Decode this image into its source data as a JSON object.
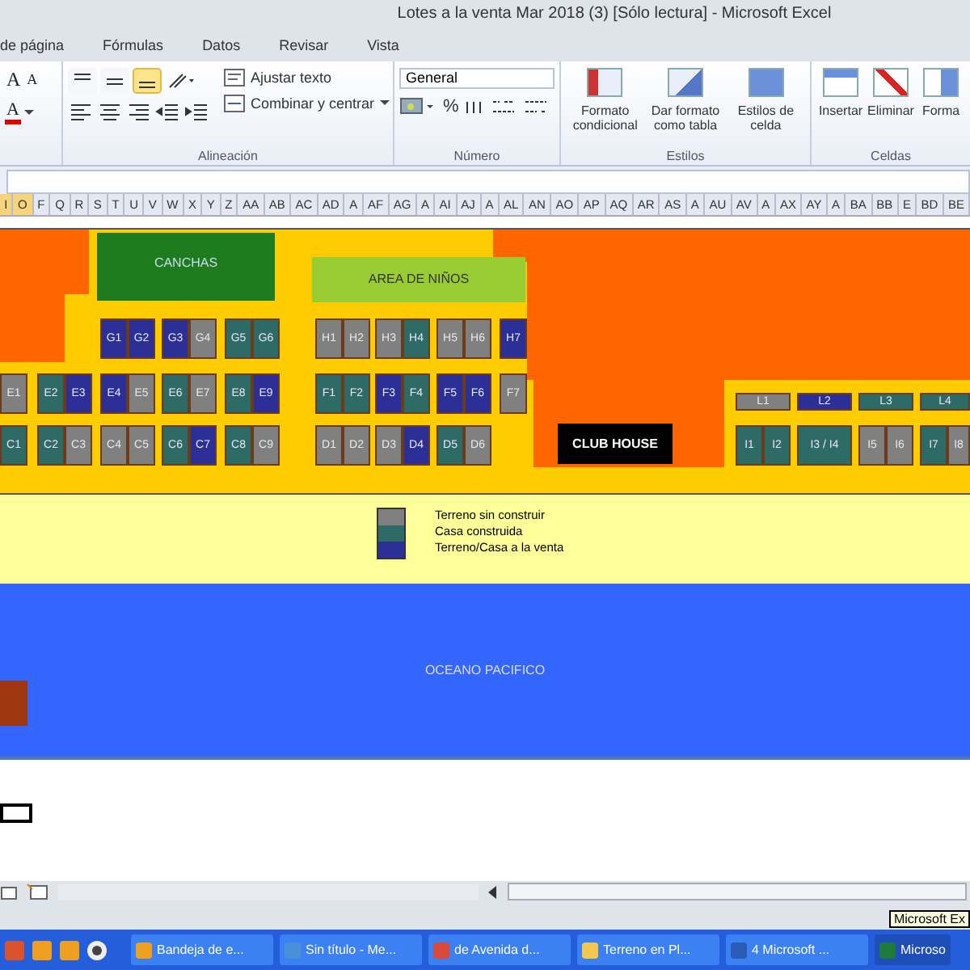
{
  "window": {
    "title": "Lotes a la venta Mar 2018 (3)  [Sólo lectura]  -  Microsoft Excel"
  },
  "ribbon_tabs": [
    "de página",
    "Fórmulas",
    "Datos",
    "Revisar",
    "Vista"
  ],
  "ribbon": {
    "font": {
      "grow": "A",
      "shrink": "A",
      "font_color": "A"
    },
    "align_buttons": [
      {
        "kind": "top",
        "on": false
      },
      {
        "kind": "middle",
        "on": false
      },
      {
        "kind": "bottom",
        "on": true
      }
    ],
    "alignment": {
      "label": "Alineación",
      "wrap_text": "Ajustar texto",
      "merge": "Combinar y centrar"
    },
    "number": {
      "label": "Número",
      "format": "General",
      "percent": "%"
    },
    "styles": {
      "label": "Estilos",
      "buttons": [
        {
          "kind": "conditional",
          "label": "Formato condicional"
        },
        {
          "kind": "table",
          "label": "Dar formato como tabla"
        },
        {
          "kind": "cell",
          "label": "Estilos de celda"
        }
      ]
    },
    "cells": {
      "label": "Celdas",
      "buttons": [
        {
          "kind": "insert",
          "label": "Insertar"
        },
        {
          "kind": "delete",
          "label": "Eliminar"
        },
        {
          "kind": "format",
          "label": "Forma"
        }
      ]
    }
  },
  "column_headers": [
    {
      "label": "I",
      "selected": true
    },
    {
      "label": "O",
      "selected": true
    },
    {
      "label": "F",
      "selected": false
    },
    {
      "label": "Q",
      "selected": false
    },
    {
      "label": "R",
      "selected": false
    },
    {
      "label": "S",
      "selected": false
    },
    {
      "label": "T",
      "selected": false
    },
    {
      "label": "U",
      "selected": false
    },
    {
      "label": "V",
      "selected": false
    },
    {
      "label": "W",
      "selected": false
    },
    {
      "label": "X",
      "selected": false
    },
    {
      "label": "Y",
      "selected": false
    },
    {
      "label": "Z",
      "selected": false
    },
    {
      "label": "AA",
      "selected": false
    },
    {
      "label": "AB",
      "selected": false
    },
    {
      "label": "AC",
      "selected": false
    },
    {
      "label": "AD",
      "selected": false
    },
    {
      "label": "A",
      "selected": false
    },
    {
      "label": "AF",
      "selected": false
    },
    {
      "label": "AG",
      "selected": false
    },
    {
      "label": "A",
      "selected": false
    },
    {
      "label": "AI",
      "selected": false
    },
    {
      "label": "AJ",
      "selected": false
    },
    {
      "label": "A",
      "selected": false
    },
    {
      "label": "AL",
      "selected": false
    },
    {
      "label": "AN",
      "selected": false
    },
    {
      "label": "AO",
      "selected": false
    },
    {
      "label": "AP",
      "selected": false
    },
    {
      "label": "AQ",
      "selected": false
    },
    {
      "label": "AR",
      "selected": false
    },
    {
      "label": "AS",
      "selected": false
    },
    {
      "label": "A",
      "selected": false
    },
    {
      "label": "AU",
      "selected": false
    },
    {
      "label": "AV",
      "selected": false
    },
    {
      "label": "A",
      "selected": false
    },
    {
      "label": "AX",
      "selected": false
    },
    {
      "label": "AY",
      "selected": false
    },
    {
      "label": "A",
      "selected": false
    },
    {
      "label": "BA",
      "selected": false
    },
    {
      "label": "BB",
      "selected": false
    },
    {
      "label": "E",
      "selected": false
    },
    {
      "label": "BD",
      "selected": false
    },
    {
      "label": "BE",
      "selected": false
    }
  ],
  "map": {
    "courts": "CANCHAS",
    "kids_area": "AREA DE NIÑOS",
    "club_house": "CLUB HOUSE",
    "ocean": "OCEANO PACIFICO",
    "lot_rows": [
      {
        "groups": [
          [
            {
              "label": "G1",
              "kind": "for_sale"
            },
            {
              "label": "G2",
              "kind": "for_sale"
            }
          ],
          [
            {
              "label": "G3",
              "kind": "for_sale"
            },
            {
              "label": "G4",
              "kind": "vacant"
            }
          ],
          [
            {
              "label": "G5",
              "kind": "built"
            },
            {
              "label": "G6",
              "kind": "built"
            }
          ],
          [
            {
              "label": "H1",
              "kind": "vacant"
            },
            {
              "label": "H2",
              "kind": "vacant"
            }
          ],
          [
            {
              "label": "H3",
              "kind": "vacant"
            },
            {
              "label": "H4",
              "kind": "built"
            }
          ],
          [
            {
              "label": "H5",
              "kind": "vacant"
            },
            {
              "label": "H6",
              "kind": "vacant"
            }
          ],
          [
            {
              "label": "H7",
              "kind": "for_sale"
            }
          ]
        ]
      },
      {
        "groups": [
          [
            {
              "label": "E1",
              "kind": "vacant"
            }
          ],
          [
            {
              "label": "E2",
              "kind": "built"
            },
            {
              "label": "E3",
              "kind": "for_sale"
            }
          ],
          [
            {
              "label": "E4",
              "kind": "for_sale"
            },
            {
              "label": "E5",
              "kind": "vacant"
            }
          ],
          [
            {
              "label": "E6",
              "kind": "built"
            },
            {
              "label": "E7",
              "kind": "vacant"
            }
          ],
          [
            {
              "label": "E8",
              "kind": "built"
            },
            {
              "label": "E9",
              "kind": "for_sale"
            }
          ],
          [
            {
              "label": "F1",
              "kind": "built"
            },
            {
              "label": "F2",
              "kind": "built"
            }
          ],
          [
            {
              "label": "F3",
              "kind": "for_sale"
            },
            {
              "label": "F4",
              "kind": "built"
            }
          ],
          [
            {
              "label": "F5",
              "kind": "for_sale"
            },
            {
              "label": "F6",
              "kind": "for_sale"
            }
          ],
          [
            {
              "label": "F7",
              "kind": "vacant"
            }
          ]
        ]
      },
      {
        "groups": [
          [
            {
              "label": "C1",
              "kind": "built"
            }
          ],
          [
            {
              "label": "C2",
              "kind": "built"
            },
            {
              "label": "C3",
              "kind": "vacant"
            }
          ],
          [
            {
              "label": "C4",
              "kind": "vacant"
            },
            {
              "label": "C5",
              "kind": "vacant"
            }
          ],
          [
            {
              "label": "C6",
              "kind": "built"
            },
            {
              "label": "C7",
              "kind": "for_sale"
            }
          ],
          [
            {
              "label": "C8",
              "kind": "built"
            },
            {
              "label": "C9",
              "kind": "vacant"
            }
          ],
          [
            {
              "label": "D1",
              "kind": "vacant"
            },
            {
              "label": "D2",
              "kind": "vacant"
            }
          ],
          [
            {
              "label": "D3",
              "kind": "vacant"
            },
            {
              "label": "D4",
              "kind": "for_sale"
            }
          ],
          [
            {
              "label": "D5",
              "kind": "built"
            },
            {
              "label": "D6",
              "kind": "vacant"
            }
          ]
        ]
      },
      {
        "groups": [
          [
            {
              "label": "L1",
              "kind": "vacant"
            }
          ],
          [
            {
              "label": "L2",
              "kind": "for_sale"
            }
          ],
          [
            {
              "label": "L3",
              "kind": "built"
            }
          ],
          [
            {
              "label": "L4",
              "kind": "built"
            }
          ]
        ]
      },
      {
        "groups": [
          [
            {
              "label": "I1",
              "kind": "built"
            },
            {
              "label": "I2",
              "kind": "built"
            }
          ],
          [
            {
              "label": "I3 / I4",
              "kind": "built"
            }
          ],
          [
            {
              "label": "I5",
              "kind": "vacant"
            },
            {
              "label": "I6",
              "kind": "vacant"
            }
          ],
          [
            {
              "label": "I7",
              "kind": "built"
            },
            {
              "label": "I8",
              "kind": "vacant"
            }
          ]
        ]
      }
    ],
    "legend": [
      {
        "kind": "vacant",
        "label": "Terreno sin construir"
      },
      {
        "kind": "built",
        "label": "Casa construida"
      },
      {
        "kind": "for_sale",
        "label": "Terreno/Casa a la venta"
      }
    ]
  },
  "tooltip": "Microsoft Ex",
  "taskbar": [
    {
      "kind": "mail",
      "label": "Bandeja de e...",
      "selected": false
    },
    {
      "kind": "paint",
      "label": "Sin título - Me...",
      "selected": false
    },
    {
      "kind": "browser",
      "label": "de Avenida d...",
      "selected": false
    },
    {
      "kind": "folder",
      "label": "Terreno en Pl...",
      "selected": false
    },
    {
      "kind": "word",
      "label": "4 Microsoft ...",
      "selected": false
    },
    {
      "kind": "excel",
      "label": "Microso",
      "selected": true
    }
  ]
}
